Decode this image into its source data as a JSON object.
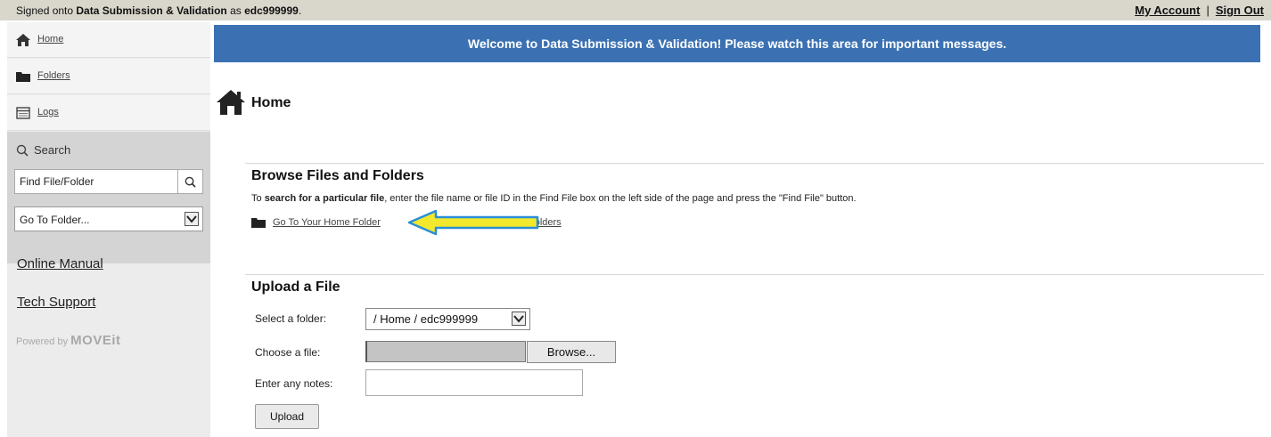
{
  "topbar": {
    "signed_prefix": "Signed onto ",
    "app_name": "Data Submission & Validation",
    "signed_mid": " as ",
    "username": "edc999999",
    "signed_suffix": ".",
    "my_account": "My Account",
    "separator": "|",
    "sign_out": "Sign Out"
  },
  "sidebar": {
    "nav": [
      {
        "label": "Home",
        "icon": "home-icon"
      },
      {
        "label": "Folders",
        "icon": "folder-icon"
      },
      {
        "label": "Logs",
        "icon": "log-icon"
      }
    ],
    "search": {
      "heading": "Search",
      "find_value": "Find File/Folder",
      "goto_value": "Go To Folder..."
    },
    "links": {
      "online_manual": "Online Manual",
      "tech_support": "Tech Support"
    },
    "powered": {
      "prefix": "Powered by ",
      "brand": "MOVEit"
    }
  },
  "banner": {
    "text": "Welcome to Data Submission & Validation! Please watch this area for important messages."
  },
  "page": {
    "title": "Home"
  },
  "browse": {
    "heading": "Browse Files and Folders",
    "desc_prefix": "To ",
    "desc_bold": "search for a particular file",
    "desc_suffix": ", enter the file name or file ID in the Find File box on the left side of the page and press the \"Find File\" button.",
    "home_folder_link": "Go To Your Home Folder",
    "folders_link": "Folders"
  },
  "upload": {
    "heading": "Upload a File",
    "select_folder_label": "Select a folder:",
    "select_folder_value": "/ Home / edc999999",
    "choose_file_label": "Choose a file:",
    "browse_button": "Browse...",
    "notes_label": "Enter any notes:",
    "notes_value": "",
    "upload_button": "Upload"
  },
  "colors": {
    "banner": "#3b71b2",
    "topbar": "#d9d6cc",
    "sidebar": "#ececec",
    "search_block": "#d4d4d4",
    "arrow_fill": "#f2e82e",
    "arrow_outline": "#2a8fd6"
  }
}
